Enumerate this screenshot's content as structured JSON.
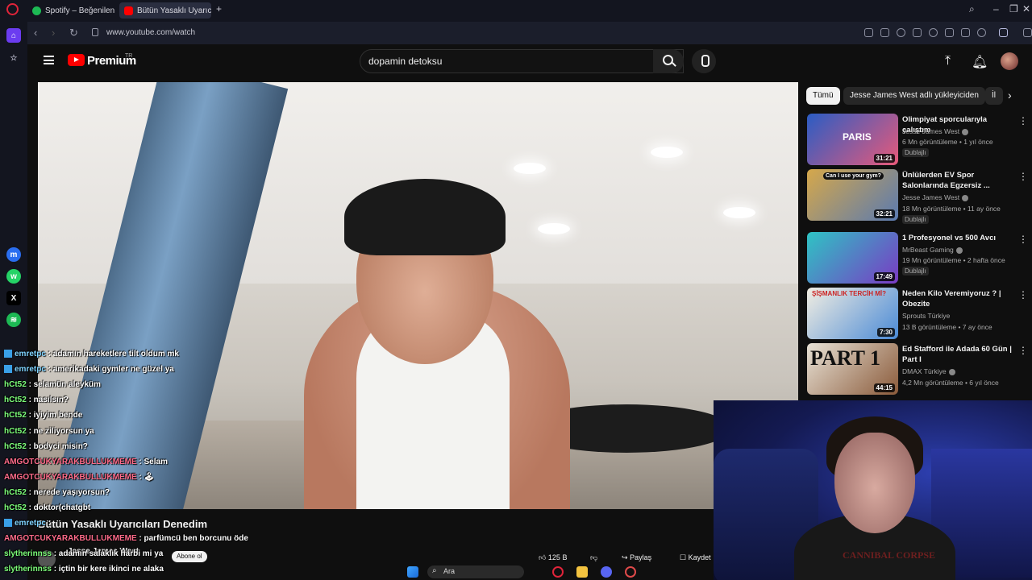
{
  "browser": {
    "tabs": [
      {
        "label": "Spotify – Beğenilen Şarkıl",
        "color": "#1db954"
      },
      {
        "label": "Bütün Yasaklı Uyarıcıl",
        "color": "#ff0000"
      }
    ],
    "url": "www.youtube.com/watch"
  },
  "youtube": {
    "brand": "Premium",
    "brand_suffix": "TR",
    "search_value": "dopamin detoksu"
  },
  "chips": [
    "Tümü",
    "Jesse James West adlı yükleyiciden",
    "İl"
  ],
  "recommendations": [
    {
      "title": "Olimpiyat sporcularıyla çalıştım",
      "channel": "Jesse James West",
      "views": "6 Mn görüntüleme • 1 yıl önce",
      "dubbed": "Dublajlı",
      "duration": "31:21",
      "thumb": [
        "#2a5cc4",
        "#e85a7a"
      ]
    },
    {
      "title": "Ünlülerden EV Spor Salonlarında Egzersiz ...",
      "channel": "Jesse James West",
      "views": "18 Mn görüntüleme • 11 ay önce",
      "dubbed": "Dublajlı",
      "duration": "32:21",
      "thumb": [
        "#d6a84a",
        "#5a7ab0"
      ]
    },
    {
      "title": "1 Profesyonel vs 500 Avcı",
      "channel": "MrBeast Gaming",
      "views": "19 Mn görüntüleme • 2 hafta önce",
      "dubbed": "Dublajlı",
      "duration": "17:49",
      "thumb": [
        "#2ec4c4",
        "#7a3ac4"
      ]
    },
    {
      "title": "Neden Kilo Veremiyoruz ? | Obezite",
      "channel": "Sprouts Türkiye",
      "views": "13 B görüntüleme • 7 ay önce",
      "dubbed": "",
      "duration": "7:30",
      "thumb": [
        "#f2eee2",
        "#4a8ad6"
      ]
    },
    {
      "title": "Ed Stafford ile Adada 60 Gün | Part I",
      "channel": "DMAX Türkiye",
      "views": "4,2 Mn görüntüleme • 6 yıl önce",
      "dubbed": "",
      "duration": "44:15",
      "thumb": [
        "#e8e2d6",
        "#8a5a3a"
      ]
    }
  ],
  "thumb_texts": {
    "r0": "PARIS",
    "r1": "Can I use your gym?",
    "r3": "ŞİŞMANLIK TERCİH Mİ?",
    "r4": "PART 1"
  },
  "video": {
    "title": "Bütün Yasaklı Uyarıcıları Denedim",
    "channel": "Jesse James West",
    "subscribe": "Abone ol",
    "likes": "125 B",
    "share": "Paylaş",
    "save": "Kaydet"
  },
  "webcam": {
    "shirt": "CANNIBAL CORPSE"
  },
  "chat": [
    {
      "user": "emretpc",
      "text": ": adamın hareketlere tilt oldum mk",
      "color": "#7fd3ff",
      "badge": true
    },
    {
      "user": "emretpc",
      "text": ": amerikadaki gymler ne güzel ya",
      "color": "#7fd3ff",
      "badge": true
    },
    {
      "user": "hCt52",
      "text": ": selamün aleyküm",
      "color": "#7dff7a",
      "badge": false
    },
    {
      "user": "hCt52",
      "text": ": nasılsın?",
      "color": "#7dff7a",
      "badge": false
    },
    {
      "user": "hCt52",
      "text": ": iyiyim bende",
      "color": "#7dff7a",
      "badge": false
    },
    {
      "user": "hCt52",
      "text": ": ne ziliyorsun ya",
      "color": "#7dff7a",
      "badge": false
    },
    {
      "user": "hCt52",
      "text": ": bodyci misin?",
      "color": "#7dff7a",
      "badge": false
    },
    {
      "user": "AMGOTCUKYARAKBULLUKMEME",
      "text": ": Selam",
      "color": "#ff6b8a",
      "badge": false
    },
    {
      "user": "AMGOTCUKYARAKBULLUKMEME",
      "text": ": 🕹",
      "color": "#ff6b8a",
      "badge": false
    },
    {
      "user": "hCt52",
      "text": ": nerede yaşıyorsun?",
      "color": "#7dff7a",
      "badge": false
    },
    {
      "user": "hCt52",
      "text": ": doktor(chatgbt",
      "color": "#7dff7a",
      "badge": false
    },
    {
      "user": "emretpc",
      "text": ":",
      "color": "#7fd3ff",
      "badge": true
    },
    {
      "user": "AMGOTCUKYARAKBULLUKMEME",
      "text": ": parfümcü ben borcunu öde",
      "color": "#ff6b8a",
      "badge": false
    },
    {
      "user": "slytherinnss",
      "text": ": adamın salaklık harbi mi ya",
      "color": "#7dff7a",
      "badge": false
    },
    {
      "user": "slytherinnss",
      "text": ": içtin bir kere ikinci ne alaka",
      "color": "#7dff7a",
      "badge": false
    }
  ],
  "taskbar": {
    "search": "Ara"
  },
  "colors": {
    "accent": "#ff0000",
    "bg": "#0f0f0f"
  }
}
